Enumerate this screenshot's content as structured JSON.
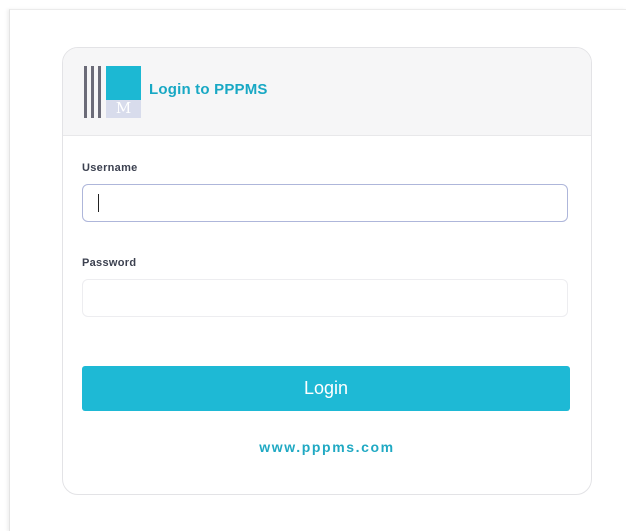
{
  "header": {
    "title": "Login to PPPMS",
    "logo_letter": "M"
  },
  "form": {
    "username_label": "Username",
    "username_value": "",
    "password_label": "Password",
    "password_value": "",
    "submit_label": "Login"
  },
  "footer": {
    "site_link": "www.pppms.com"
  },
  "colors": {
    "accent": "#1eb9d5",
    "title": "#18a8c4",
    "header_bg": "#f6f6f7"
  }
}
